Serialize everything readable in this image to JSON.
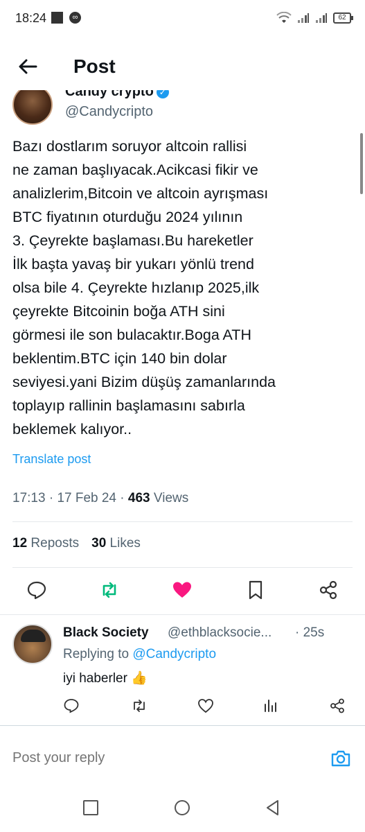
{
  "status_bar": {
    "time": "18:24",
    "battery": "62"
  },
  "header": {
    "title": "Post"
  },
  "post": {
    "author_name": "Candy crypto",
    "author_handle": "@Candycripto",
    "text": "Bazı dostlarım soruyor altcoin rallisi\nne zaman başlıyacak.Acikcasi fikir ve\nanalizlerim,Bitcoin ve altcoin ayrışması\nBTC fiyatının oturduğu 2024 yılının\n3. Çeyrekte başlaması.Bu hareketler\nİlk başta yavaş bir yukarı yönlü trend\nolsa bile 4. Çeyrekte hızlanıp 2025,ilk\nçeyrekte Bitcoinin boğa ATH sini\ngörmesi ile son bulacaktır.Boga ATH\nbeklentim.BTC için 140 bin dolar\nseviyesi.yani Bizim düşüş zamanlarında\ntoplayıp rallinin başlamasını sabırla\nbeklemek kalıyor..",
    "translate_label": "Translate post",
    "time": "17:13",
    "date": "17 Feb 24",
    "views_count": "463",
    "views_label": "Views",
    "reposts_count": "12",
    "reposts_label": "Reposts",
    "likes_count": "30",
    "likes_label": "Likes"
  },
  "reply": {
    "name": "Black Society",
    "handle": "@ethblacksocie...",
    "time": "· 25s",
    "replying_prefix": "Replying to",
    "replying_to": "@Candycripto",
    "text": "iyi haberler 👍"
  },
  "compose": {
    "placeholder": "Post your reply"
  },
  "colors": {
    "accent": "#1d9bf0",
    "repost_active": "#00ba7c",
    "like_active": "#f91880",
    "secondary_text": "#536471"
  }
}
